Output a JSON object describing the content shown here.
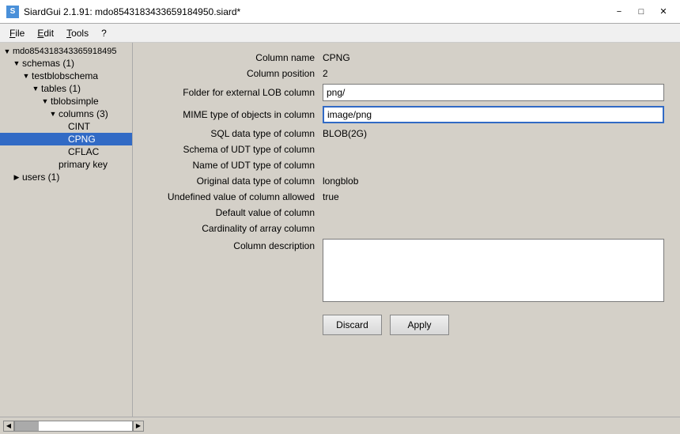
{
  "titleBar": {
    "title": "SiardGui 2.1.91: mdo854318343365918495​0.siard*",
    "iconLabel": "S",
    "minimizeLabel": "−",
    "maximizeLabel": "□",
    "closeLabel": "✕"
  },
  "menuBar": {
    "items": [
      {
        "id": "file",
        "label": "File",
        "underlineIndex": 0
      },
      {
        "id": "edit",
        "label": "Edit",
        "underlineIndex": 0
      },
      {
        "id": "tools",
        "label": "Tools",
        "underlineIndex": 0
      },
      {
        "id": "help",
        "label": "?",
        "underlineIndex": -1
      }
    ]
  },
  "sidebar": {
    "tree": [
      {
        "id": "root",
        "label": "mdo854318343365918495",
        "indent": 0,
        "arrow": "▼",
        "selected": false
      },
      {
        "id": "schemas",
        "label": "schemas (1)",
        "indent": 1,
        "arrow": "▼",
        "selected": false
      },
      {
        "id": "testblobschema",
        "label": "testblobschema",
        "indent": 2,
        "arrow": "▼",
        "selected": false
      },
      {
        "id": "tables",
        "label": "tables (1)",
        "indent": 3,
        "arrow": "▼",
        "selected": false
      },
      {
        "id": "tblobsimple",
        "label": "tblobsimple",
        "indent": 4,
        "arrow": "▼",
        "selected": false
      },
      {
        "id": "columns",
        "label": "columns (3)",
        "indent": 5,
        "arrow": "▼",
        "selected": false
      },
      {
        "id": "cint",
        "label": "CINT",
        "indent": 6,
        "arrow": "",
        "selected": false
      },
      {
        "id": "cpng",
        "label": "CPNG",
        "indent": 6,
        "arrow": "",
        "selected": true
      },
      {
        "id": "cflac",
        "label": "CFLAC",
        "indent": 6,
        "arrow": "",
        "selected": false
      },
      {
        "id": "primarykey",
        "label": "primary key",
        "indent": 5,
        "arrow": "",
        "selected": false
      },
      {
        "id": "users",
        "label": "users (1)",
        "indent": 1,
        "arrow": "▶",
        "selected": false
      }
    ]
  },
  "form": {
    "fields": [
      {
        "id": "column-name",
        "label": "Column name",
        "value": "CPNG",
        "type": "text",
        "inputType": "none"
      },
      {
        "id": "column-position",
        "label": "Column position",
        "value": "2",
        "type": "text",
        "inputType": "none"
      },
      {
        "id": "folder-external-lob",
        "label": "Folder for external LOB column",
        "value": "png/",
        "type": "input",
        "inputType": "text"
      },
      {
        "id": "mime-type",
        "label": "MIME type of objects in column",
        "value": "image/png",
        "type": "input",
        "inputType": "text",
        "focused": true
      },
      {
        "id": "sql-data-type",
        "label": "SQL data type of column",
        "value": "BLOB(2G)",
        "type": "text",
        "inputType": "none"
      },
      {
        "id": "schema-udt",
        "label": "Schema of UDT type of column",
        "value": "",
        "type": "text",
        "inputType": "none"
      },
      {
        "id": "name-udt",
        "label": "Name of UDT type of column",
        "value": "",
        "type": "text",
        "inputType": "none"
      },
      {
        "id": "original-data-type",
        "label": "Original data type of column",
        "value": "longblob",
        "type": "text",
        "inputType": "none"
      },
      {
        "id": "undefined-allowed",
        "label": "Undefined value of column allowed",
        "value": "true",
        "type": "text",
        "inputType": "none"
      },
      {
        "id": "default-value",
        "label": "Default value of column",
        "value": "",
        "type": "text",
        "inputType": "none"
      },
      {
        "id": "cardinality",
        "label": "Cardinality of array column",
        "value": "",
        "type": "text",
        "inputType": "none"
      },
      {
        "id": "column-description",
        "label": "Column description",
        "value": "",
        "type": "textarea",
        "inputType": "textarea"
      }
    ],
    "buttons": {
      "discard": "Discard",
      "apply": "Apply"
    }
  }
}
